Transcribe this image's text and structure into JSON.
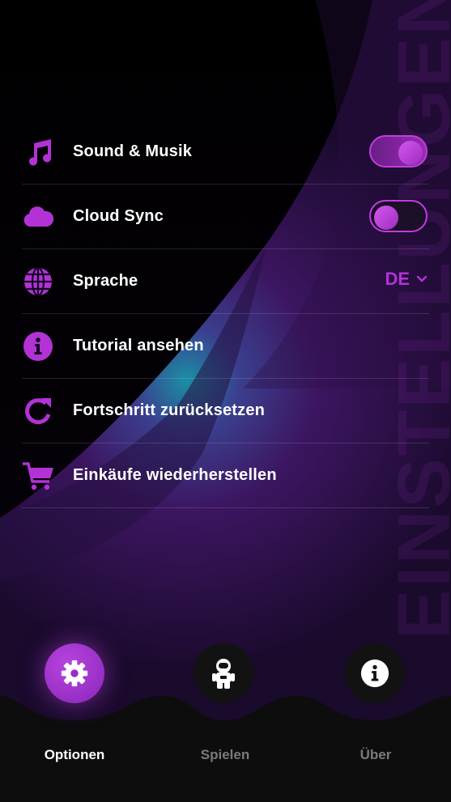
{
  "settings": {
    "items": [
      {
        "label": "Sound & Musik",
        "icon": "music-note-icon",
        "control": "toggle",
        "value": true
      },
      {
        "label": "Cloud Sync",
        "icon": "cloud-icon",
        "control": "toggle",
        "value": false
      },
      {
        "label": "Sprache",
        "icon": "globe-icon",
        "control": "dropdown",
        "value": "DE"
      },
      {
        "label": "Tutorial ansehen",
        "icon": "info-icon",
        "control": "none"
      },
      {
        "label": "Fortschritt zurücksetzen",
        "icon": "reset-icon",
        "control": "none"
      },
      {
        "label": "Einkäufe wiederherstellen",
        "icon": "cart-icon",
        "control": "none"
      }
    ]
  },
  "watermark": "EINSTELLUNGEN",
  "bottom_nav": {
    "items": [
      {
        "label": "Optionen",
        "icon": "gear-icon",
        "active": true
      },
      {
        "label": "Spielen",
        "icon": "astronaut-icon",
        "active": false
      },
      {
        "label": "Über",
        "icon": "info-icon",
        "active": false
      }
    ]
  },
  "colors": {
    "accent": "#b232d6",
    "background": "#000000",
    "nav_background": "#0d0d0d"
  }
}
